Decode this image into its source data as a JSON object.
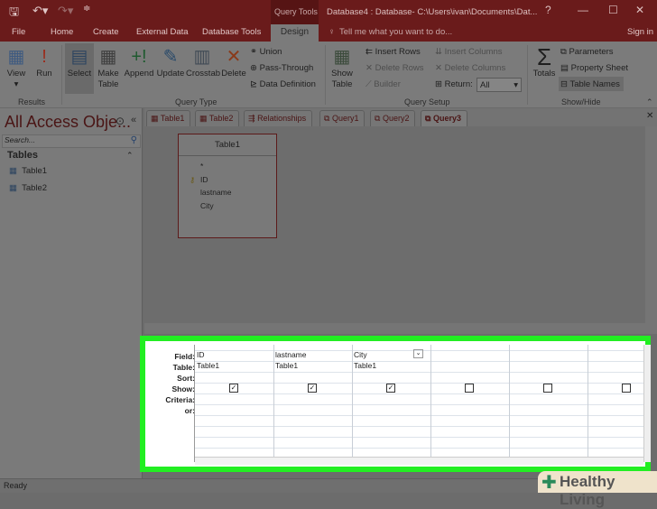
{
  "titlebar": {
    "context": "Query Tools",
    "title": "Database4 : Database- C:\\Users\\ivan\\Documents\\Dat...",
    "help": "?",
    "minimize": "—",
    "maximize": "☐",
    "close": "✕"
  },
  "tabs": [
    "File",
    "Home",
    "Create",
    "External Data",
    "Database Tools",
    "Design"
  ],
  "tell_me": "Tell me what you want to do...",
  "sign_in": "Sign in",
  "ribbon": {
    "results": {
      "label": "Results",
      "view": "View",
      "run": "Run"
    },
    "query_type": {
      "label": "Query Type",
      "select": "Select",
      "make_table": "Make Table",
      "append": "Append",
      "update": "Update",
      "crosstab": "Crosstab",
      "delete": "Delete",
      "union": "Union",
      "pass_through": "Pass-Through",
      "data_definition": "Data Definition"
    },
    "query_setup": {
      "label": "Query Setup",
      "show_table": "Show Table",
      "insert_rows": "Insert Rows",
      "delete_rows": "Delete Rows",
      "builder": "Builder",
      "insert_columns": "Insert Columns",
      "delete_columns": "Delete Columns",
      "return_label": "Return:",
      "return_value": "All"
    },
    "show_hide": {
      "label": "Show/Hide",
      "totals": "Totals",
      "parameters": "Parameters",
      "property_sheet": "Property Sheet",
      "table_names": "Table Names"
    }
  },
  "nav": {
    "title": "All Access Obje...",
    "search_placeholder": "Search...",
    "section": "Tables",
    "items": [
      "Table1",
      "Table2"
    ]
  },
  "doc_tabs": [
    "Table1",
    "Table2",
    "Relationships",
    "Query1",
    "Query2",
    "Query3"
  ],
  "table_box": {
    "title": "Table1",
    "fields": [
      "*",
      "ID",
      "lastname",
      "City"
    ]
  },
  "grid": {
    "row_labels": [
      "Field:",
      "Table:",
      "Sort:",
      "Show:",
      "Criteria:",
      "or:"
    ],
    "columns": [
      {
        "field": "ID",
        "table": "Table1",
        "show": true
      },
      {
        "field": "lastname",
        "table": "Table1",
        "show": true
      },
      {
        "field": "City",
        "table": "Table1",
        "show": true
      },
      {
        "field": "",
        "table": "",
        "show": false
      },
      {
        "field": "",
        "table": "",
        "show": false
      },
      {
        "field": "",
        "table": "",
        "show": false
      }
    ]
  },
  "status": "Ready",
  "watermark": "Healthy Living"
}
